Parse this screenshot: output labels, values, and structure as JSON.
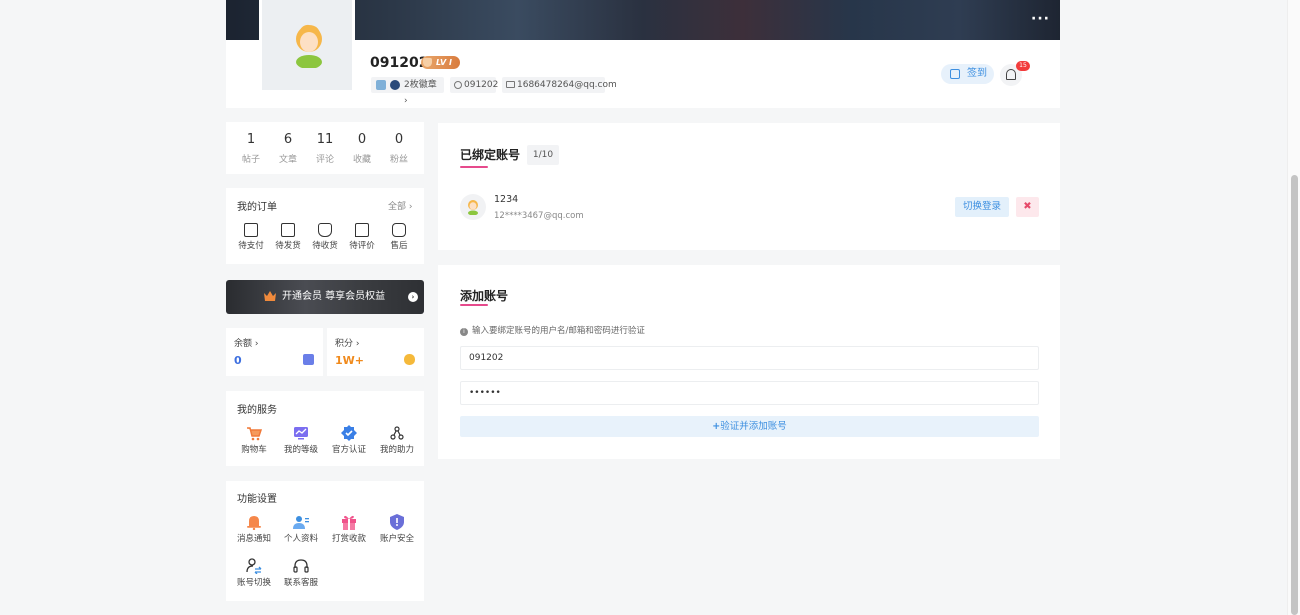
{
  "header": {
    "username": "091202",
    "level": "LV I",
    "medals": "2枚徽章",
    "user_id": "091202",
    "email": "1686478264@qq.com",
    "signin_label": "签到",
    "notification_count": "15",
    "more": "···"
  },
  "stats": [
    {
      "value": "1",
      "label": "帖子"
    },
    {
      "value": "6",
      "label": "文章"
    },
    {
      "value": "11",
      "label": "评论"
    },
    {
      "value": "0",
      "label": "收藏"
    },
    {
      "value": "0",
      "label": "粉丝"
    }
  ],
  "orders": {
    "title": "我的订单",
    "all_label": "全部",
    "items": [
      {
        "label": "待支付",
        "icon": "wallet-icon"
      },
      {
        "label": "待发货",
        "icon": "package-icon"
      },
      {
        "label": "待收货",
        "icon": "truck-icon"
      },
      {
        "label": "待评价",
        "icon": "comment-icon"
      },
      {
        "label": "售后",
        "icon": "return-icon"
      }
    ]
  },
  "vip": {
    "label": "开通会员 尊享会员权益"
  },
  "wallet": {
    "balance_label": "余额",
    "balance_value": "0",
    "points_label": "积分",
    "points_value": "1W+",
    "balance_color": "#3d6fe0",
    "points_color": "#f08a1c"
  },
  "services": {
    "title": "我的服务",
    "items": [
      {
        "label": "购物车",
        "icon": "cart-icon"
      },
      {
        "label": "我的等级",
        "icon": "level-icon"
      },
      {
        "label": "官方认证",
        "icon": "verified-icon"
      },
      {
        "label": "我的助力",
        "icon": "share-icon"
      }
    ]
  },
  "settings": {
    "title": "功能设置",
    "items": [
      {
        "label": "消息通知",
        "icon": "bell-icon"
      },
      {
        "label": "个人资料",
        "icon": "profile-icon"
      },
      {
        "label": "打赏收款",
        "icon": "gift-icon"
      },
      {
        "label": "账户安全",
        "icon": "shield-icon"
      },
      {
        "label": "账号切换",
        "icon": "switch-user-icon"
      },
      {
        "label": "联系客服",
        "icon": "headset-icon"
      }
    ]
  },
  "bound_accounts": {
    "title": "已绑定账号",
    "count": "1/10",
    "accounts": [
      {
        "name": "1234",
        "email": "12****3467@qq.com",
        "switch_label": "切换登录",
        "delete_label": "✖"
      }
    ]
  },
  "add_account": {
    "title": "添加账号",
    "hint": "输入要绑定账号的用户名/邮箱和密码进行验证",
    "username_value": "091202",
    "password_value": "••••••",
    "submit_label": "验证并添加账号"
  },
  "colors": {
    "accent": "#3d8fe0",
    "underline": "#e64a8c"
  }
}
